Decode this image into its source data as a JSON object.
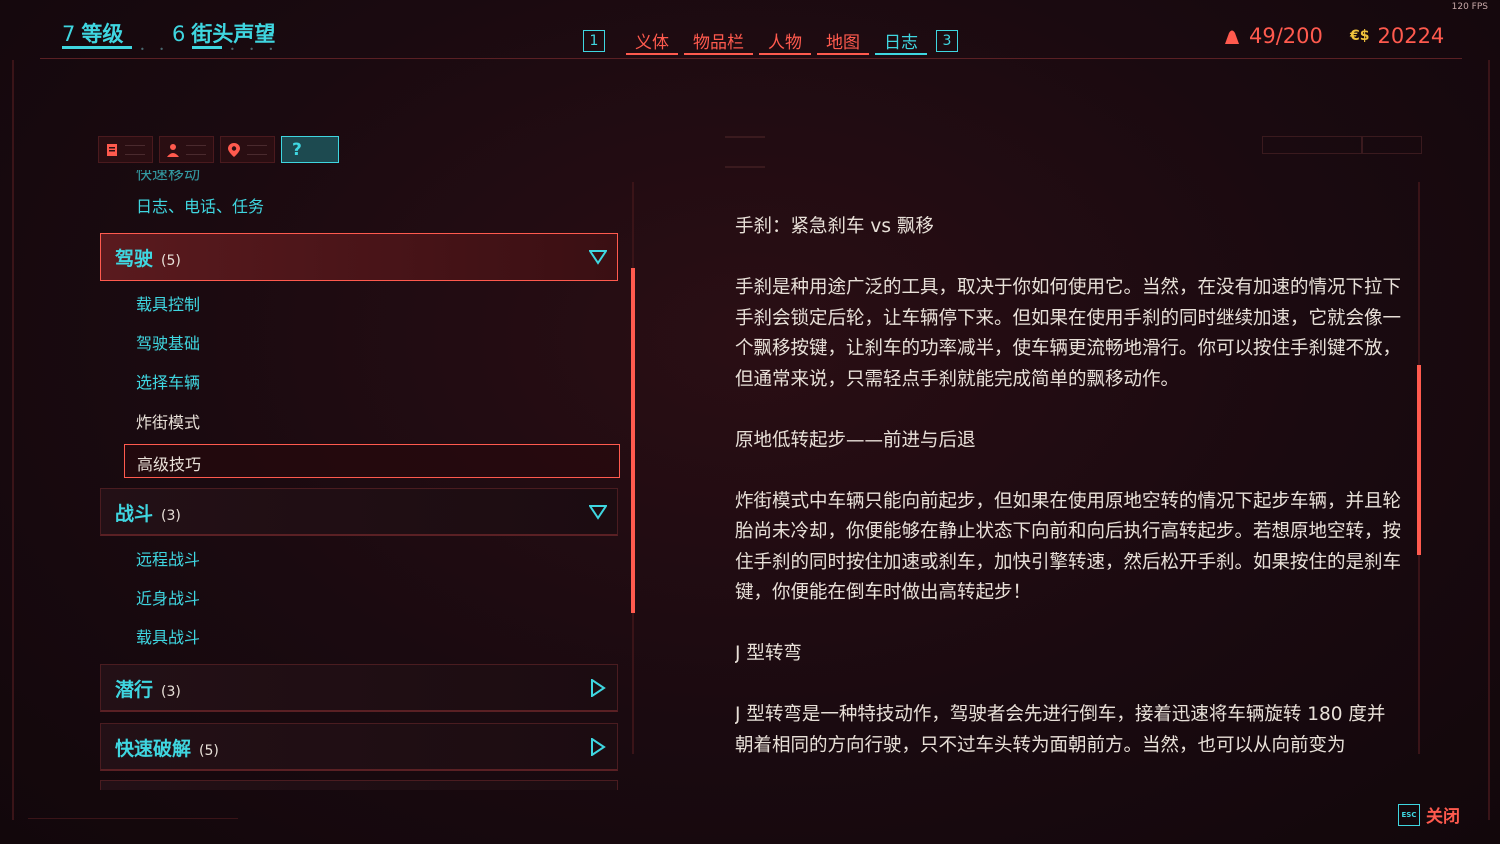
{
  "fps": "120 FPS",
  "stats": {
    "level_num": "7",
    "level_label": "等级",
    "street_num": "6",
    "street_label": "街头声望"
  },
  "nav": {
    "key_left": "1",
    "tabs": [
      "义体",
      "物品栏",
      "人物",
      "地图",
      "日志"
    ],
    "active_tab": "日志",
    "key_right": "3"
  },
  "weight": "49/200",
  "money": {
    "symbol": "€$",
    "value": "20224"
  },
  "filters": {
    "help_label": "?"
  },
  "left_list": {
    "item_top": "日志、电话、任务",
    "categories": [
      {
        "label": "驾驶",
        "count": "(5)",
        "expanded": true,
        "items": [
          "载具控制",
          "驾驶基础",
          "选择车辆",
          "炸街模式",
          "高级技巧"
        ],
        "selected": "高级技巧"
      },
      {
        "label": "战斗",
        "count": "(3)",
        "expanded": true,
        "items": [
          "远程战斗",
          "近身战斗",
          "载具战斗"
        ]
      },
      {
        "label": "潜行",
        "count": "(3)",
        "expanded": false
      },
      {
        "label": "快速破解",
        "count": "(5)",
        "expanded": false
      }
    ]
  },
  "article": {
    "paragraphs": [
      "手刹：紧急刹车 vs 飘移",
      "手刹是种用途广泛的工具，取决于你如何使用它。当然，在没有加速的情况下拉下手刹会锁定后轮，让车辆停下来。但如果在使用手刹的同时继续加速，它就会像一个飘移按键，让刹车的功率减半，使车辆更流畅地滑行。你可以按住手刹键不放，但通常来说，只需轻点手刹就能完成简单的飘移动作。",
      "原地低转起步——前进与后退",
      "炸街模式中车辆只能向前起步，但如果在使用原地空转的情况下起步车辆，并且轮胎尚未冷却，你便能够在静止状态下向前和向后执行高转起步。若想原地空转，按住手刹的同时按住加速或刹车，加快引擎转速，然后松开手刹。如果按住的是刹车键，你便能在倒车时做出高转起步！",
      "J 型转弯",
      "J 型转弯是一种特技动作，驾驶者会先进行倒车，接着迅速将车辆旋转 180 度并朝着相同的方向行驶，只不过车头转为面朝前方。当然，也可以从向前变为"
    ]
  },
  "close": {
    "key": "ESC",
    "label": "关闭"
  },
  "colors": {
    "red": "#ff5a4e",
    "cyan": "#3fd6e0",
    "gold": "#f0c23c",
    "bg": "#1a0a10"
  }
}
